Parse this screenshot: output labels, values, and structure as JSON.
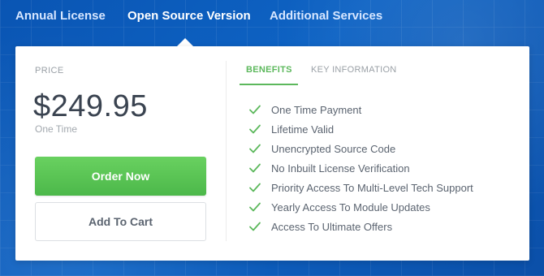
{
  "tabs": [
    {
      "label": "Annual License",
      "active": false
    },
    {
      "label": "Open Source Version",
      "active": true
    },
    {
      "label": "Additional Services",
      "active": false
    }
  ],
  "pricing": {
    "price_label": "PRICE",
    "price": "$249.95",
    "period": "One Time",
    "order_button": "Order Now",
    "cart_button": "Add To Cart"
  },
  "info": {
    "tabs": [
      {
        "label": "BENEFITS",
        "active": true
      },
      {
        "label": "KEY INFORMATION",
        "active": false
      }
    ],
    "benefits": [
      "One Time Payment",
      "Lifetime Valid",
      "Unencrypted Source Code",
      "No Inbuilt License Verification",
      "Priority Access To Multi-Level Tech Support",
      "Yearly Access To Module Updates",
      "Access To Ultimate Offers"
    ]
  },
  "colors": {
    "background": "#0b58b5",
    "accent_green": "#5cb85c",
    "card": "#ffffff"
  },
  "icons": {
    "benefit": "check-icon"
  }
}
